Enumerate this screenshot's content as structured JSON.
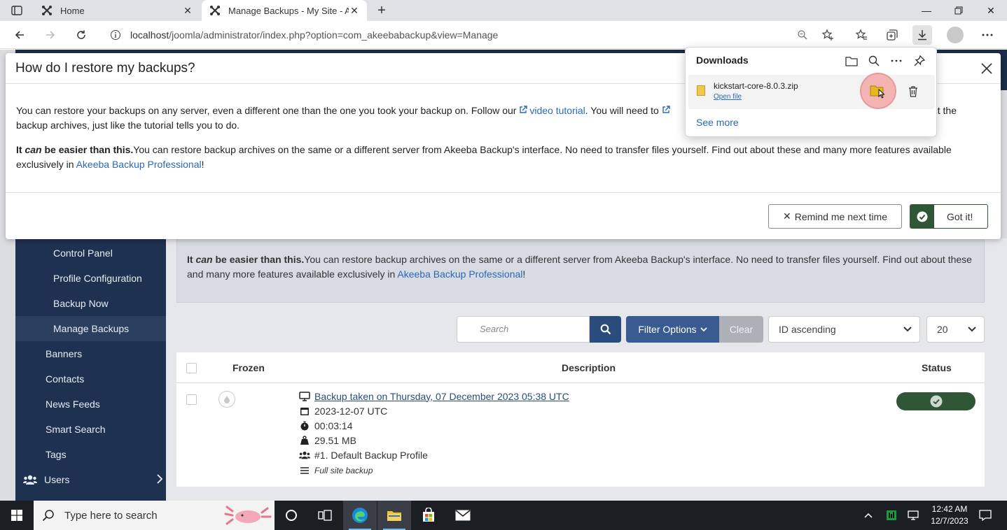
{
  "browser": {
    "tabs": [
      {
        "title": "Home"
      },
      {
        "title": "Manage Backups - My Site - Adm"
      }
    ],
    "url_host": "localhost",
    "url_path": "/joomla/administrator/index.php?option=com_akeebabackup&view=Manage"
  },
  "downloads": {
    "title": "Downloads",
    "file_name": "kickstart-core-8.0.3.zip",
    "open_file": "Open file",
    "see_more": "See more"
  },
  "modal": {
    "title": "How do I restore my backups?",
    "p1_start": "You can restore your backups on any server, even a different one than the one you took your backup on. Follow our ",
    "p1_link1": "video tutorial",
    "p1_mid": ". You will need to ",
    "p1_end": "ct the",
    "p1_line2": "backup archives, just like the tutorial tells you to do.",
    "p2_bold_1": "It ",
    "p2_bold_em": "can",
    "p2_bold_2": " be easier than this.",
    "p2_text": "You can restore backup archives on the same or a different server from Akeeba Backup's interface. No need to transfer files yourself. Find out about these and many more features available exclusively in ",
    "p2_link": "Akeeba Backup Professional",
    "p2_end": "!",
    "remind_btn": "Remind me next time",
    "gotit_btn": "Got it!"
  },
  "sidebar": {
    "items": [
      {
        "label": "Control Panel"
      },
      {
        "label": "Profile Configuration"
      },
      {
        "label": "Backup Now"
      },
      {
        "label": "Manage Backups"
      },
      {
        "label": "Banners"
      },
      {
        "label": "Contacts"
      },
      {
        "label": "News Feeds"
      },
      {
        "label": "Smart Search"
      },
      {
        "label": "Tags"
      },
      {
        "label": "Users"
      }
    ]
  },
  "info_box": {
    "bold_1": "It ",
    "bold_em": "can",
    "bold_2": " be easier than this.",
    "text": "You can restore backup archives on the same or a different server from Akeeba Backup's interface. No need to transfer files yourself. Find out about these and many more features available exclusively in ",
    "link": "Akeeba Backup Professional",
    "end": "!"
  },
  "filters": {
    "search_placeholder": "Search",
    "filter_options": "Filter Options",
    "clear": "Clear",
    "sort_value": "ID ascending",
    "limit_value": "20"
  },
  "table": {
    "headers": {
      "frozen": "Frozen",
      "description": "Description",
      "status": "Status"
    },
    "row": {
      "title": "Backup taken on Thursday, 07 December 2023 05:38 UTC",
      "date": "2023-12-07 UTC",
      "duration": "00:03:14",
      "size": "29.51 MB",
      "profile": "#1. Default Backup Profile",
      "type": "Full site backup"
    }
  },
  "taskbar": {
    "search_placeholder": "Type here to search",
    "time": "12:42 AM",
    "date": "12/7/2023"
  },
  "colors": {
    "accent_blue": "#2a4c7d",
    "success_green": "#2f5736",
    "sidebar_bg": "#1f3150"
  }
}
